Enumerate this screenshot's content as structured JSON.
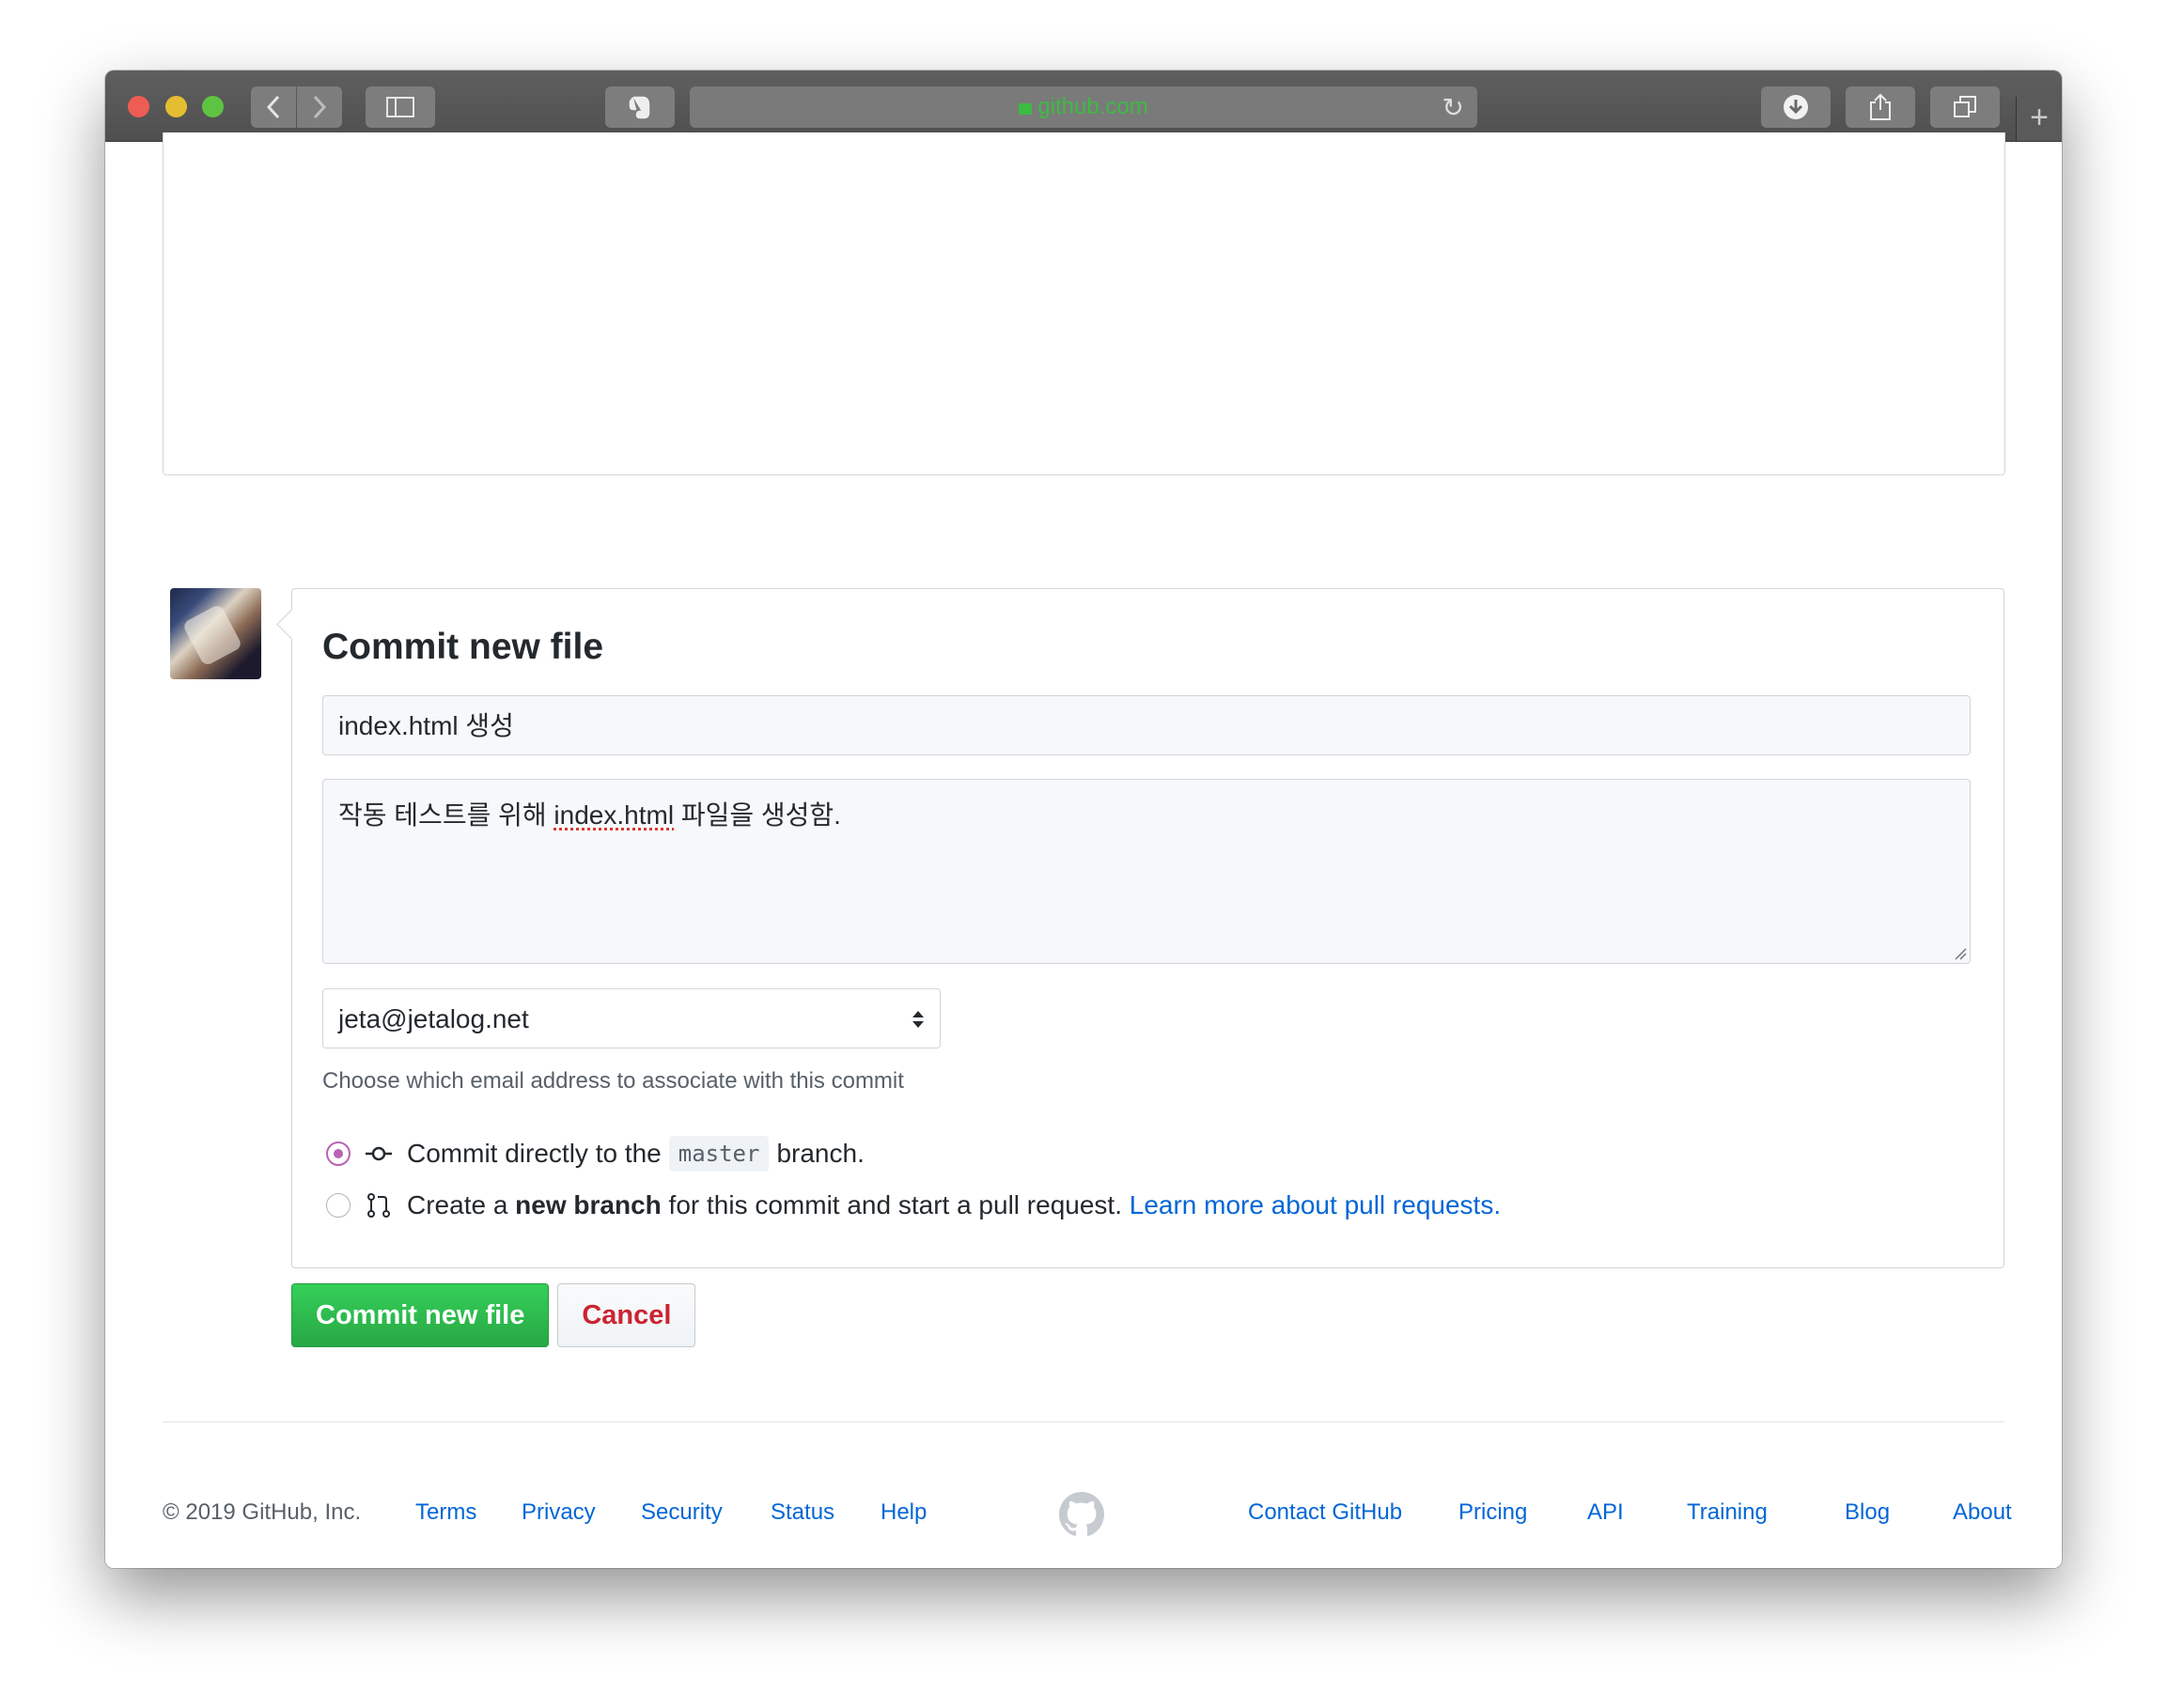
{
  "browser": {
    "url": "github.com"
  },
  "commit": {
    "title": "Commit new file",
    "summary_value": "index.html 생성",
    "description_before": "작동 테스트를 위해 ",
    "description_misspelled": "index.html",
    "description_after": " 파일을 생성함.",
    "email_selected": "jeta@jetalog.net",
    "email_note": "Choose which email address to associate with this commit",
    "option_direct": {
      "prefix": "Commit directly to the",
      "branch": "master",
      "suffix": "branch."
    },
    "option_new_branch": {
      "prefix": "Create a ",
      "bold": "new branch",
      "suffix": " for this commit and start a pull request. ",
      "link": "Learn more about pull requests."
    },
    "submit_label": "Commit new file",
    "cancel_label": "Cancel"
  },
  "footer": {
    "copyright": "© 2019 GitHub, Inc.",
    "left_links": [
      "Terms",
      "Privacy",
      "Security",
      "Status",
      "Help"
    ],
    "right_links": [
      "Contact GitHub",
      "Pricing",
      "API",
      "Training",
      "Blog",
      "About"
    ]
  },
  "colors": {
    "accent_green": "#28a745",
    "link_blue": "#0366d6",
    "cancel_red": "#cb2431",
    "radio_purple": "#b863b4"
  }
}
